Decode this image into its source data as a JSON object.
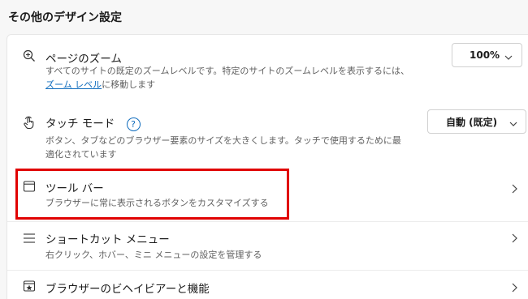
{
  "section_title": "その他のデザイン設定",
  "zoom": {
    "title": "ページのズーム",
    "desc_line1": "すべてのサイトの既定のズームレベルです。特定のサイトのズームレベルを表示するには、",
    "desc_link": "ズーム レベル",
    "desc_after_link": "に移動します",
    "dropdown_value": "100%",
    "icon": "zoom-in-icon"
  },
  "touch": {
    "title": "タッチ モード",
    "desc_line1": "ボタン、タブなどのブラウザー要素のサイズを大きくします。タッチで使用するために最",
    "desc_line2": "適化されています",
    "dropdown_value": "自動 (既定)",
    "help_glyph": "?",
    "icon": "touch-icon"
  },
  "toolbar": {
    "title": "ツール バー",
    "desc": "ブラウザーに常に表示されるボタンをカスタマイズする",
    "icon": "window-icon"
  },
  "shortcut_menu": {
    "title": "ショートカット メニュー",
    "desc": "右クリック、ホバー、ミニ メニューの設定を管理する",
    "icon": "menu-icon"
  },
  "browser_behavior": {
    "title": "ブラウザーのビヘイビアーと機能",
    "icon": "browser-star-icon"
  },
  "colors": {
    "link": "#0f6cbd",
    "highlight": "#e00000",
    "accent_help": "#0f6cbd"
  }
}
